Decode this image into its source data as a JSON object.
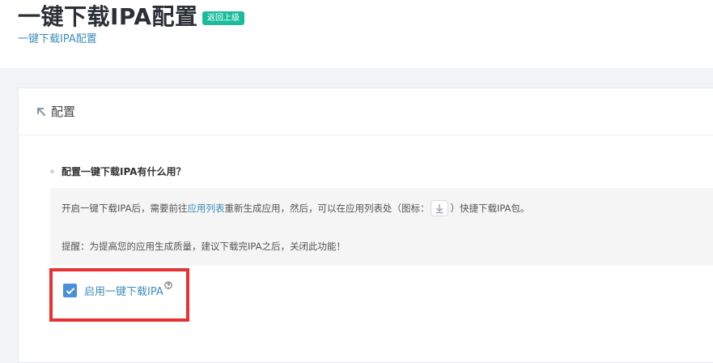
{
  "header": {
    "title": "一键下载IPA配置",
    "back_label": "返回上级",
    "breadcrumb": "一键下载IPA配置"
  },
  "panel": {
    "heading": "配置",
    "question": "配置一键下载IPA有什么用？",
    "info": {
      "line1_part1": "开启一键下载IPA后，需要前往",
      "line1_link": "应用列表",
      "line1_part2": "重新生成应用，然后，可以在应用列表处（图标：",
      "line1_part3": "）快捷下载IPA包。",
      "line2": "提醒：为提高您的应用生成质量，建议下载完IPA之后，关闭此功能！"
    },
    "checkbox": {
      "label": "启用一键下载IPA",
      "checked": true
    }
  },
  "colors": {
    "accent_green": "#1abc9c",
    "link_blue": "#3c8dbc",
    "checkbox_blue": "#4a90d9",
    "highlight_red": "#e83232"
  },
  "icons": {
    "back_arrow": "arrow-up-left-icon",
    "download": "download-icon",
    "check": "check-icon",
    "help": "question-circle-icon"
  }
}
